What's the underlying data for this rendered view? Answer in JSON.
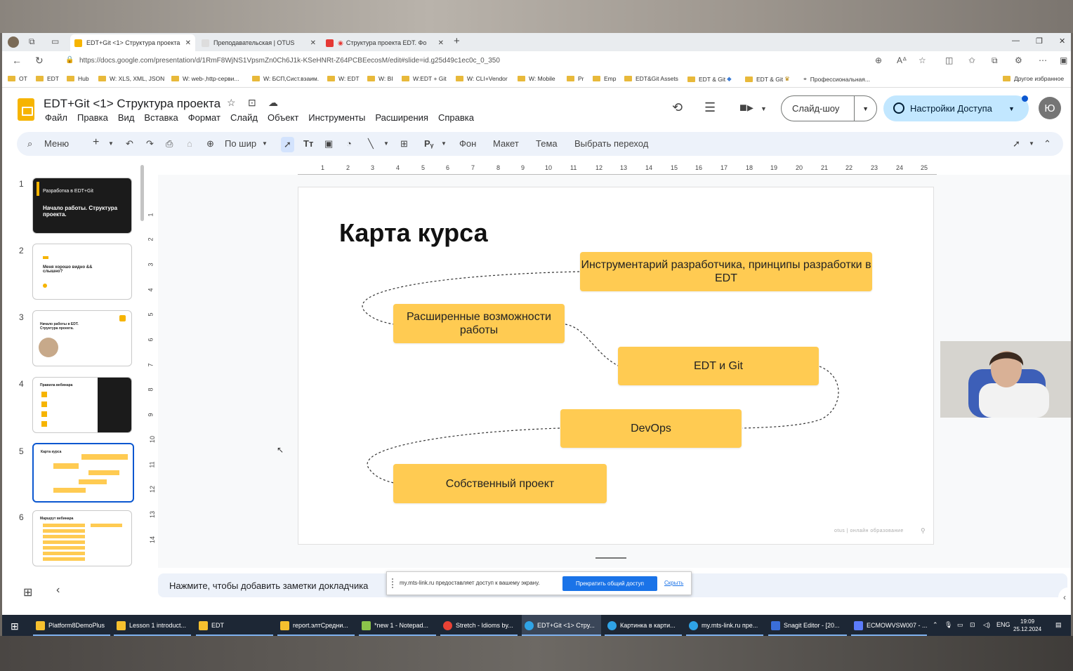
{
  "browser": {
    "tabs": [
      {
        "label": "EDT+Git <1> Структура проекта",
        "active": true
      },
      {
        "label": "Преподавательская | OTUS",
        "active": false
      },
      {
        "label": "Структура проекта EDT. Фо",
        "active": false
      }
    ],
    "url": "https://docs.google.com/presentation/d/1RmF8WjNS1VpsmZn0Ch6J1k-KSeHNRt-Z64PCBEecosM/edit#slide=id.g25d49c1ec0c_0_350",
    "bookmarks": [
      "OT",
      "EDT",
      "Hub",
      "W: XLS, XML, JSON",
      "W: web-,http-серви...",
      "W: БСП,Сист.взаим.",
      "W: EDT",
      "W: BI",
      "W:EDT + Git",
      "W: CLI+Vendor",
      "W: Mobile",
      "Pr",
      "Emp",
      "EDT&Git Assets",
      "EDT & Git",
      "EDT & Git",
      "Профессиональная...",
      "Другое избранное"
    ]
  },
  "app": {
    "doc_title": "EDT+Git <1> Структура проекта",
    "menu": [
      "Файл",
      "Правка",
      "Вид",
      "Вставка",
      "Формат",
      "Слайд",
      "Объект",
      "Инструменты",
      "Расширения",
      "Справка"
    ],
    "slideshow_label": "Слайд-шоу",
    "share_label": "Настройки Доступа",
    "avatar_letter": "Ю"
  },
  "toolbar": {
    "menu_label": "Меню",
    "zoom_label": "По шир",
    "background_label": "Фон",
    "layout_label": "Макет",
    "theme_label": "Тема",
    "transition_label": "Выбрать переход"
  },
  "ruler": {
    "h": [
      "1",
      "2",
      "3",
      "4",
      "5",
      "6",
      "7",
      "8",
      "9",
      "10",
      "11",
      "12",
      "13",
      "14",
      "15",
      "16",
      "17",
      "18",
      "19",
      "20",
      "21",
      "22",
      "23",
      "24",
      "25"
    ],
    "v": [
      "1",
      "2",
      "3",
      "4",
      "5",
      "6",
      "7",
      "8",
      "9",
      "10",
      "11",
      "12",
      "13",
      "14"
    ]
  },
  "filmstrip": {
    "slides": [
      {
        "num": "1",
        "line1": "Разработка в EDT+Git",
        "line2": "Начало работы. Структура проекта."
      },
      {
        "num": "2",
        "line1": "Меня хорошо видно && слышно?",
        "line2": ""
      },
      {
        "num": "3",
        "line1": "Начало работы в EDT. Структура проекта.",
        "line2": ""
      },
      {
        "num": "4",
        "line1": "Правила вебинара",
        "line2": ""
      },
      {
        "num": "5",
        "line1": "Карта курса",
        "line2": ""
      },
      {
        "num": "6",
        "line1": "Маршрут вебинара",
        "line2": ""
      }
    ]
  },
  "slide": {
    "title": "Карта курса",
    "nodes": [
      {
        "text": "Инструментарий разработчика, принципы разработки в EDT"
      },
      {
        "text": "Расширенные возможности работы"
      },
      {
        "text": "EDT и Git"
      },
      {
        "text": "DevOps"
      },
      {
        "text": "Собственный проект"
      }
    ],
    "footer": "otus | онлайн образование"
  },
  "notes": {
    "placeholder": "Нажмите, чтобы добавить заметки докладчика"
  },
  "share_popup": {
    "message": "my.mts-link.ru предоставляет доступ к вашему экрану.",
    "stop_label": "Прекратить общий доступ",
    "hide_label": "Скрыть"
  },
  "taskbar": {
    "items": [
      "Platform8DemoPlus",
      "Lesson 1 introduct...",
      "EDT",
      "report.элтСредни...",
      "*new 1 - Notepad...",
      "Stretch - Idioms by...",
      "EDT+Git <1> Стру...",
      "Картинка в карти...",
      "my.mts-link.ru пре...",
      "Snagit Editor - [20...",
      "ECMOWVSW007 - ..."
    ],
    "lang": "ENG",
    "time": "19:09",
    "date": "25.12.2024"
  },
  "colors": {
    "node_fill": "#ffcb52",
    "accent": "#0b57d0",
    "share_bg": "#c2e7ff"
  }
}
